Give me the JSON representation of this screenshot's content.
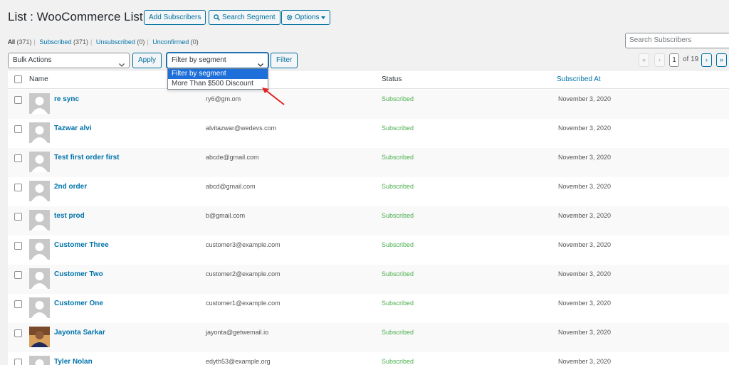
{
  "header": {
    "title": "List : WooCommerce List",
    "add_subscribers": "Add Subscribers",
    "search_segment": "Search Segment",
    "options": "Options"
  },
  "status_links": [
    {
      "label": "All",
      "count": "(371)"
    },
    {
      "label": "Subscribed",
      "count": "(371)"
    },
    {
      "label": "Unsubscribed",
      "count": "(0)"
    },
    {
      "label": "Unconfirmed",
      "count": "(0)"
    }
  ],
  "search": {
    "placeholder": "Search Subscribers"
  },
  "toolbar": {
    "bulk_actions": "Bulk Actions",
    "apply": "Apply",
    "segment_filter": "Filter by segment",
    "filter": "Filter"
  },
  "segment_dropdown": {
    "options": [
      "Filter by segment",
      "More Than $500 Discount"
    ],
    "selected_index": 0
  },
  "pagination": {
    "first": "«",
    "prev": "‹",
    "current": "1",
    "of_total": "of 19",
    "next": "›",
    "last": "»"
  },
  "table": {
    "columns": [
      "Name",
      "Status",
      "Subscribed At"
    ],
    "rows": [
      {
        "name": "re sync",
        "email": "ry6@gm.om",
        "status": "Subscribed",
        "date": "November 3, 2020",
        "photo": false
      },
      {
        "name": "Tazwar alvi",
        "email": "alvitazwar@wedevs.com",
        "status": "Subscribed",
        "date": "November 3, 2020",
        "photo": false
      },
      {
        "name": "Test first order first",
        "email": "abcde@gmail.com",
        "status": "Subscribed",
        "date": "November 3, 2020",
        "photo": false
      },
      {
        "name": "2nd order",
        "email": "abcd@gmail.com",
        "status": "Subscribed",
        "date": "November 3, 2020",
        "photo": false
      },
      {
        "name": "test prod",
        "email": "b@gmail.com",
        "status": "Subscribed",
        "date": "November 3, 2020",
        "photo": false
      },
      {
        "name": "Customer Three",
        "email": "customer3@example.com",
        "status": "Subscribed",
        "date": "November 3, 2020",
        "photo": false
      },
      {
        "name": "Customer Two",
        "email": "customer2@example.com",
        "status": "Subscribed",
        "date": "November 3, 2020",
        "photo": false
      },
      {
        "name": "Customer One",
        "email": "customer1@example.com",
        "status": "Subscribed",
        "date": "November 3, 2020",
        "photo": false
      },
      {
        "name": "Jayonta Sarkar",
        "email": "jayonta@getwemail.io",
        "status": "Subscribed",
        "date": "November 3, 2020",
        "photo": true
      },
      {
        "name": "Tyler Nolan",
        "email": "edyth53@example.org",
        "status": "Subscribed",
        "date": "November 3, 2020",
        "photo": false
      }
    ]
  },
  "colors": {
    "link": "#0073aa",
    "status_subscribed": "#4caf50",
    "dropdown_highlight": "#1e6fd9",
    "annotation_arrow": "#e02424"
  }
}
